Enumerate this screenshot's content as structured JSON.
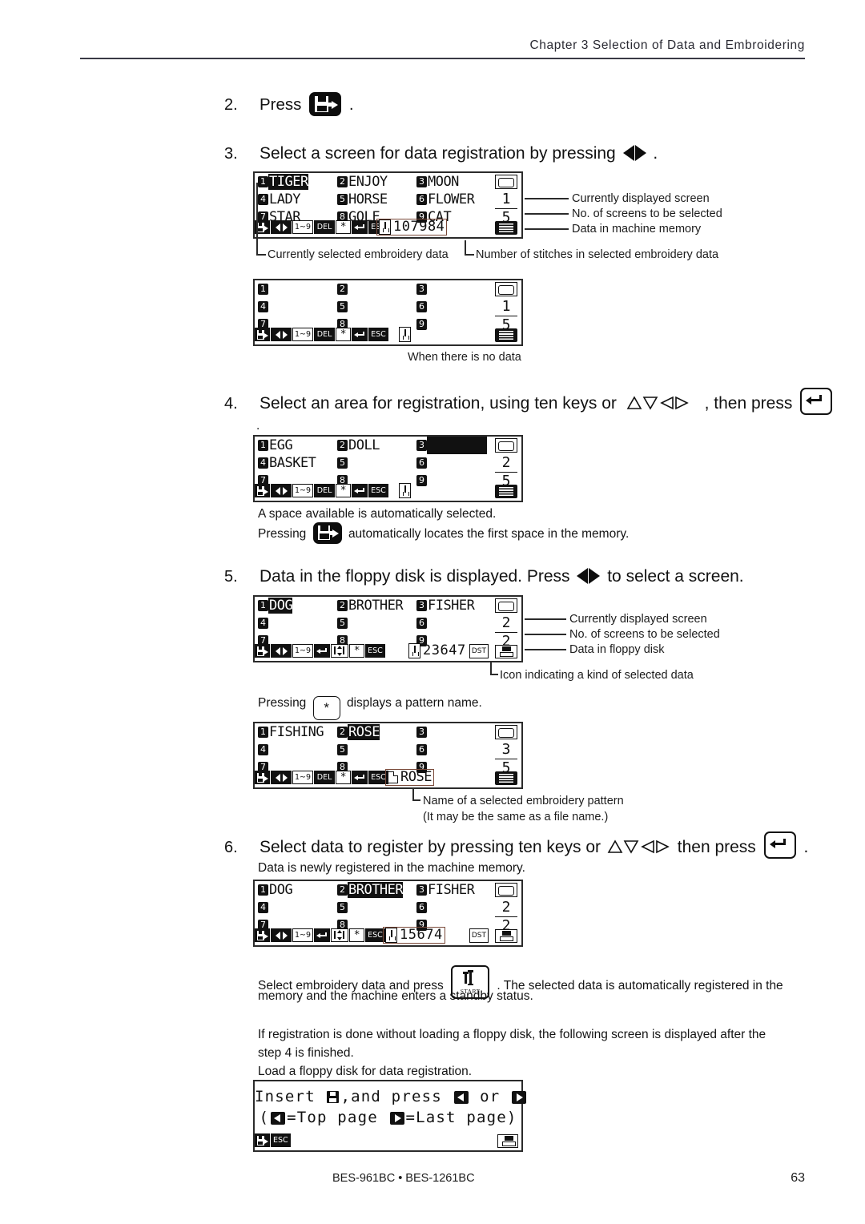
{
  "header": {
    "chapter_title": "Chapter 3 Selection of Data and Embroidering"
  },
  "footer": {
    "model": "BES-961BC • BES-1261BC",
    "page_number": "63"
  },
  "steps": {
    "s2": {
      "num": "2.",
      "text_before": "Press",
      "text_after": ".",
      "icon": "save-floppy-key-icon"
    },
    "s3": {
      "num": "3.",
      "text_before": "Select a screen for data registration by pressing",
      "text_after": ".",
      "icon": "left-right-arrow-icon"
    },
    "s4": {
      "num": "4.",
      "text_before": "Select an area for registration, using ten keys or",
      "text_middle": ", then press",
      "text_after": ".",
      "icon_arrows": "four-direction-arrows-icon",
      "icon_enter": "enter-key-icon"
    },
    "s5": {
      "num": "5.",
      "text": "Data in the floppy disk is displayed.  Press",
      "text_after": "to select a screen.",
      "icon": "left-right-arrow-icon"
    },
    "s6": {
      "num": "6.",
      "text_before": "Select data to register by pressing ten keys or",
      "text_middle": "then press",
      "text_after": ".",
      "icon_arrows": "four-direction-arrows-icon",
      "icon_enter": "enter-key-icon"
    }
  },
  "notes": {
    "auto_space": "A space available is automatically selected.",
    "pressing_locates_before": "Pressing",
    "pressing_locates_after": "automatically locates the first space in the memory.",
    "pressing_ast_before": "Pressing",
    "pressing_ast_after": "displays a pattern name.",
    "asterisk_label": "*",
    "step6_sub": "Data is newly registered in the machine memory.",
    "start_before": "Select embroidery data and press",
    "start_after": ".  The selected data is automatically registered in the",
    "start_line2": "memory and the machine enters a standby status.",
    "start_key_label": "START",
    "no_floppy_l1": "If registration is done without loading a floppy disk, the following screen is displayed after the",
    "no_floppy_l2": "step 4 is finished.",
    "no_floppy_l3": "Load a floppy disk for data registration."
  },
  "annotations": {
    "current_screen": "Currently displayed screen",
    "num_screens": "No. of screens to be selected",
    "machine_memory": "Data in machine memory",
    "floppy_data": "Data in floppy disk",
    "selected_data": "Currently selected embroidery data",
    "num_stitches": "Number of stitches in selected embroidery data",
    "no_data": "When there is no data",
    "kind_icon": "Icon indicating a kind of selected data",
    "pattern_name_l1": "Name of a selected embroidery pattern",
    "pattern_name_l2": "(It may be the same as a file name.)"
  },
  "lcd_screens": {
    "memory_full": {
      "name": "machine-memory-list",
      "slots": [
        {
          "num": "1",
          "label": "TIGER",
          "selected": true
        },
        {
          "num": "2",
          "label": "ENJOY",
          "selected": false
        },
        {
          "num": "3",
          "label": "MOON",
          "selected": false
        },
        {
          "num": "4",
          "label": "LADY",
          "selected": false
        },
        {
          "num": "5",
          "label": "HORSE",
          "selected": false
        },
        {
          "num": "6",
          "label": "FLOWER",
          "selected": false
        },
        {
          "num": "7",
          "label": "STAR",
          "selected": false
        },
        {
          "num": "8",
          "label": "GOLF",
          "selected": false
        },
        {
          "num": "9",
          "label": "CAT",
          "selected": false
        }
      ],
      "current_screen": "1",
      "total_screens": "5",
      "stitches": "107984",
      "toolbar": [
        "save",
        "leftright",
        "1~9",
        "DEL",
        "*",
        "enter",
        "ESC"
      ],
      "source_icon": "memory-chip-icon"
    },
    "memory_empty": {
      "name": "machine-memory-empty",
      "slots": [
        {
          "num": "1",
          "label": "",
          "selected": false
        },
        {
          "num": "2",
          "label": "",
          "selected": false
        },
        {
          "num": "3",
          "label": "",
          "selected": false
        },
        {
          "num": "4",
          "label": "",
          "selected": false
        },
        {
          "num": "5",
          "label": "",
          "selected": false
        },
        {
          "num": "6",
          "label": "",
          "selected": false
        },
        {
          "num": "7",
          "label": "",
          "selected": false
        },
        {
          "num": "8",
          "label": "",
          "selected": false
        },
        {
          "num": "9",
          "label": "",
          "selected": false
        }
      ],
      "current_screen": "1",
      "total_screens": "5",
      "stitches": "",
      "toolbar": [
        "save",
        "leftright",
        "1~9",
        "DEL",
        "*",
        "enter",
        "ESC"
      ],
      "source_icon": "memory-chip-icon"
    },
    "register_area": {
      "name": "registration-area-select",
      "slots": [
        {
          "num": "1",
          "label": "EGG",
          "selected": false
        },
        {
          "num": "2",
          "label": "DOLL",
          "selected": false
        },
        {
          "num": "3",
          "label": "",
          "selected": true
        },
        {
          "num": "4",
          "label": "BASKET",
          "selected": false
        },
        {
          "num": "5",
          "label": "",
          "selected": false
        },
        {
          "num": "6",
          "label": "",
          "selected": false
        },
        {
          "num": "7",
          "label": "",
          "selected": false
        },
        {
          "num": "8",
          "label": "",
          "selected": false
        },
        {
          "num": "9",
          "label": "",
          "selected": false
        }
      ],
      "current_screen": "2",
      "total_screens": "5",
      "stitches": "",
      "toolbar": [
        "save",
        "leftright",
        "1~9",
        "DEL",
        "*",
        "enter",
        "ESC"
      ],
      "source_icon": "memory-chip-icon"
    },
    "floppy_list": {
      "name": "floppy-disk-list",
      "slots": [
        {
          "num": "1",
          "label": "DOG",
          "selected": true
        },
        {
          "num": "2",
          "label": "BROTHER",
          "selected": false
        },
        {
          "num": "3",
          "label": "FISHER",
          "selected": false
        },
        {
          "num": "4",
          "label": "",
          "selected": false
        },
        {
          "num": "5",
          "label": "",
          "selected": false
        },
        {
          "num": "6",
          "label": "",
          "selected": false
        },
        {
          "num": "7",
          "label": "",
          "selected": false
        },
        {
          "num": "8",
          "label": "",
          "selected": false
        },
        {
          "num": "9",
          "label": "",
          "selected": false
        }
      ],
      "current_screen": "2",
      "total_screens": "2",
      "stitches": "23647",
      "data_kind": "DST",
      "toolbar": [
        "save",
        "leftright",
        "1~9",
        "enter",
        "updown",
        "*",
        "ESC"
      ],
      "source_icon": "floppy-disk-icon"
    },
    "pattern_name": {
      "name": "pattern-name-display",
      "slots": [
        {
          "num": "1",
          "label": "FISHING",
          "selected": false
        },
        {
          "num": "2",
          "label": "ROSE",
          "selected": true
        },
        {
          "num": "3",
          "label": "",
          "selected": false
        },
        {
          "num": "4",
          "label": "",
          "selected": false
        },
        {
          "num": "5",
          "label": "",
          "selected": false
        },
        {
          "num": "6",
          "label": "",
          "selected": false
        },
        {
          "num": "7",
          "label": "",
          "selected": false
        },
        {
          "num": "8",
          "label": "",
          "selected": false
        },
        {
          "num": "9",
          "label": "",
          "selected": false
        }
      ],
      "current_screen": "3",
      "total_screens": "5",
      "pattern": "ROSE",
      "toolbar": [
        "save",
        "leftright",
        "1~9",
        "DEL",
        "*",
        "enter",
        "ESC"
      ],
      "source_icon": "memory-chip-icon"
    },
    "registered": {
      "name": "registered-result",
      "slots": [
        {
          "num": "1",
          "label": "DOG",
          "selected": false
        },
        {
          "num": "2",
          "label": "BROTHER",
          "selected": true
        },
        {
          "num": "3",
          "label": "FISHER",
          "selected": false
        },
        {
          "num": "4",
          "label": "",
          "selected": false
        },
        {
          "num": "5",
          "label": "",
          "selected": false
        },
        {
          "num": "6",
          "label": "",
          "selected": false
        },
        {
          "num": "7",
          "label": "",
          "selected": false
        },
        {
          "num": "8",
          "label": "",
          "selected": false
        },
        {
          "num": "9",
          "label": "",
          "selected": false
        }
      ],
      "current_screen": "2",
      "total_screens": "2",
      "stitches": "15674",
      "data_kind": "DST",
      "toolbar": [
        "save",
        "leftright",
        "1~9",
        "enter",
        "updown",
        "*",
        "ESC"
      ],
      "source_icon": "floppy-disk-icon"
    },
    "insert_dialog": {
      "name": "insert-floppy-dialog",
      "line1_a": "Insert",
      "line1_b": ",and press",
      "line1_c": "or",
      "line2_a": "(",
      "line2_b": "=Top page",
      "line2_c": "=Last page)",
      "toolbar": [
        "save",
        "ESC"
      ],
      "source_icon": "floppy-disk-icon"
    }
  },
  "toolbar_labels": {
    "range": "1~9",
    "del": "DEL",
    "esc": "ESC",
    "ast": "*",
    "dst": "DST"
  }
}
